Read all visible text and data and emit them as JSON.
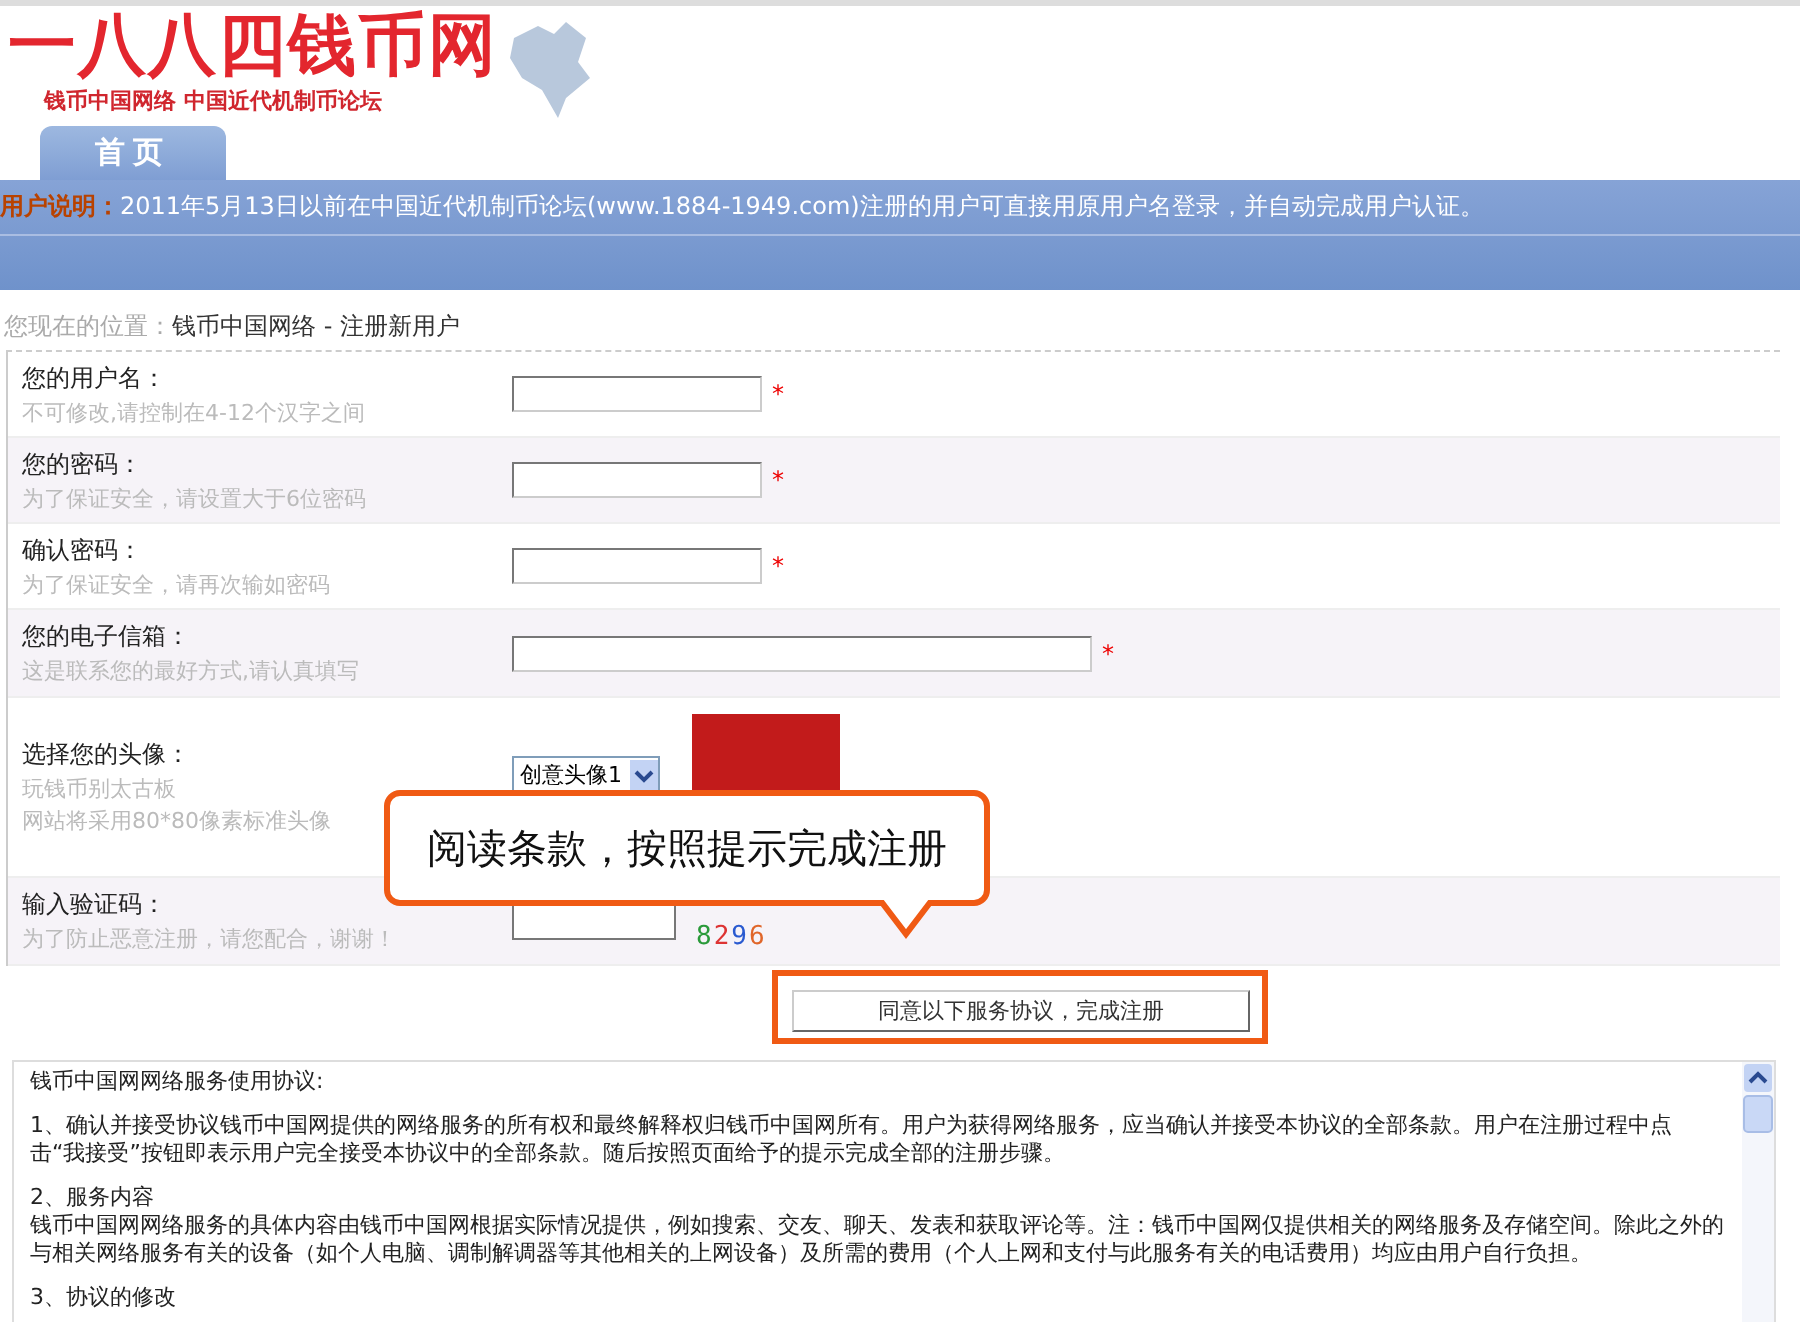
{
  "logo": {
    "title": "一八八四钱币网",
    "subtitle": "钱币中国网络  中国近代机制币论坛"
  },
  "tabs": [
    {
      "label": "首页",
      "selected": true
    }
  ],
  "notice": {
    "label": "用户说明：",
    "text": "2011年5月13日以前在中国近代机制币论坛(www.1884-1949.com)注册的用户可直接用原用户名登录，并自动完成用户认证。"
  },
  "breadcrumb": {
    "label": "您现在的位置：",
    "path": "钱币中国网络 - 注册新用户"
  },
  "form": [
    {
      "kind": "text",
      "label": "您的用户名：",
      "hint": "不可修改,请控制在4-12个汉字之间",
      "required": "*",
      "wide": false
    },
    {
      "kind": "text",
      "label": "您的密码：",
      "hint": "为了保证安全，请设置大于6位密码",
      "required": "*",
      "wide": false
    },
    {
      "kind": "text",
      "label": "确认密码：",
      "hint": "为了保证安全，请再次输如密码",
      "required": "*",
      "wide": false
    },
    {
      "kind": "text",
      "label": "您的电子信箱：",
      "hint": "这是联系您的最好方式,请认真填写",
      "required": "*",
      "wide": true
    },
    {
      "kind": "avatar",
      "label": "选择您的头像：",
      "hints": [
        "玩钱币别太古板",
        "网站将采用80*80像素标准头像"
      ],
      "value": "创意头像1"
    },
    {
      "kind": "captcha",
      "label": "输入验证码：",
      "hint": "为了防止恶意注册，请您配合，谢谢！",
      "code": "8296"
    }
  ],
  "submit": "同意以下服务协议，完成注册",
  "callout": "阅读条款，按照提示完成注册",
  "agreement": [
    "钱币中国网网络服务使用协议:",
    "1、确认并接受协议钱币中国网提供的网络服务的所有权和最终解释权归钱币中国网所有。用户为获得网络服务，应当确认并接受本协议的全部条款。用户在注册过程中点击“我接受”按钮即表示用户完全接受本协议中的全部条款。随后按照页面给予的提示完成全部的注册步骤。",
    "2、服务内容",
    "钱币中国网网络服务的具体内容由钱币中国网根据实际情况提供，例如搜索、交友、聊天、发表和获取评论等。注：钱币中国网仅提供相关的网络服务及存储空间。除此之外的与相关网络服务有关的设备（如个人电脑、调制解调器等其他相关的上网设备）及所需的费用（个人上网和支付与此服务有关的电话费用）均应由用户自行负担。",
    "3、协议的修改"
  ]
}
